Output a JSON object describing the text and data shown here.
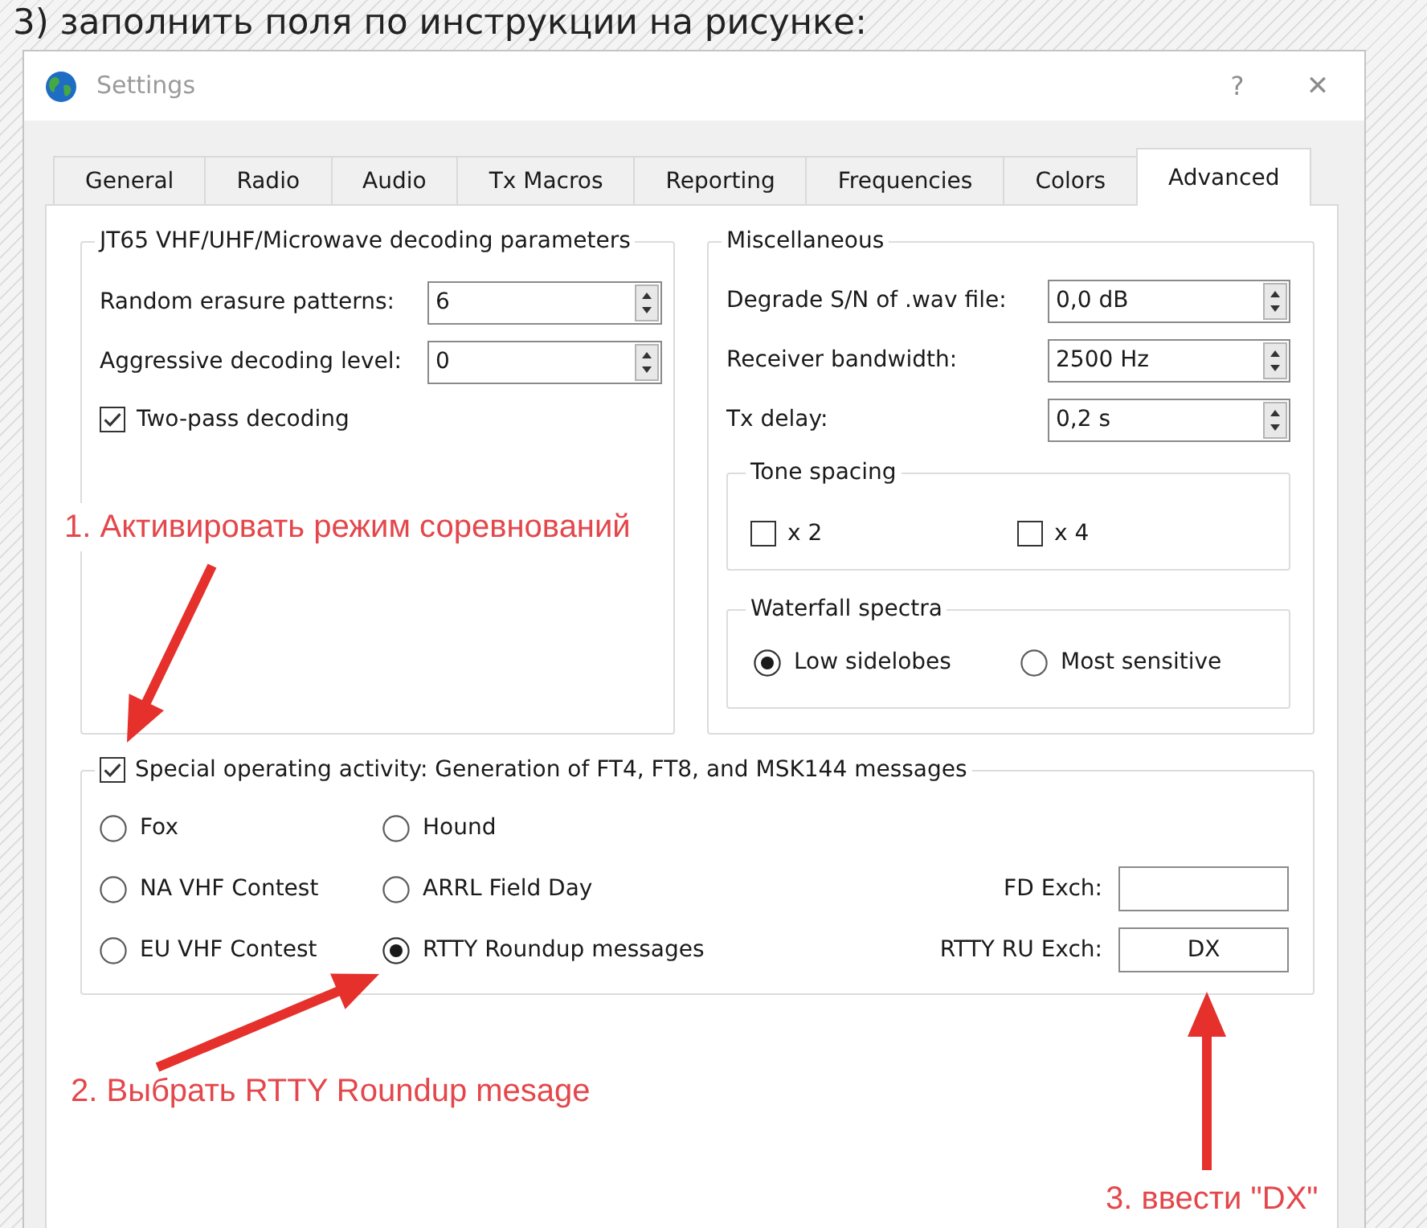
{
  "heading": "3) заполнить поля по инструкции на рисунке:",
  "window": {
    "title": "Settings",
    "buttons": [
      {
        "kind": "help",
        "label": "?"
      },
      {
        "kind": "close",
        "label": "✕"
      }
    ]
  },
  "tabs": [
    {
      "label": "General",
      "selected": false
    },
    {
      "label": "Radio",
      "selected": false
    },
    {
      "label": "Audio",
      "selected": false
    },
    {
      "label": "Tx Macros",
      "selected": false
    },
    {
      "label": "Reporting",
      "selected": false
    },
    {
      "label": "Frequencies",
      "selected": false
    },
    {
      "label": "Colors",
      "selected": false
    },
    {
      "label": "Advanced",
      "selected": true
    }
  ],
  "decoding_group": {
    "title": "JT65 VHF/UHF/Microwave decoding parameters",
    "spinboxes": [
      {
        "label": "Random erasure patterns:",
        "value": "6"
      },
      {
        "label": "Aggressive decoding level:",
        "value": "0"
      }
    ],
    "checkboxes": [
      {
        "label": "Two-pass decoding",
        "checked": true
      }
    ]
  },
  "misc_group": {
    "title": "Miscellaneous",
    "spinboxes": [
      {
        "label": "Degrade S/N of .wav file:",
        "value": "0,0 dB"
      },
      {
        "label": "Receiver bandwidth:",
        "value": "2500 Hz"
      },
      {
        "label": "Tx delay:",
        "value": "0,2 s"
      }
    ],
    "tone_spacing": {
      "title": "Tone spacing",
      "checkboxes": [
        {
          "label": "x 2",
          "checked": false
        },
        {
          "label": "x 4",
          "checked": false
        }
      ]
    },
    "waterfall_spectra": {
      "title": "Waterfall spectra",
      "radios": [
        {
          "label": "Low sidelobes",
          "selected": true
        },
        {
          "label": "Most sensitive",
          "selected": false
        }
      ]
    }
  },
  "special_activity": {
    "title": "Special operating activity: Generation of FT4, FT8, and MSK144 messages",
    "checked": true,
    "radios": [
      {
        "label": "Fox",
        "selected": false
      },
      {
        "label": "Hound",
        "selected": false
      },
      {
        "label": "NA VHF Contest",
        "selected": false
      },
      {
        "label": "ARRL Field Day",
        "selected": false
      },
      {
        "label": "EU VHF Contest",
        "selected": false
      },
      {
        "label": "RTTY Roundup messages",
        "selected": true
      }
    ],
    "exchanges": [
      {
        "label": "FD Exch:"
      },
      {
        "label": "RTTY RU Exch:",
        "value": "DX"
      }
    ]
  },
  "annotations": [
    {
      "text": "1. Активировать режим соревнований"
    },
    {
      "text": "2. Выбрать RTTY Roundup mesage"
    },
    {
      "text": "3. ввести \"DX\""
    }
  ]
}
